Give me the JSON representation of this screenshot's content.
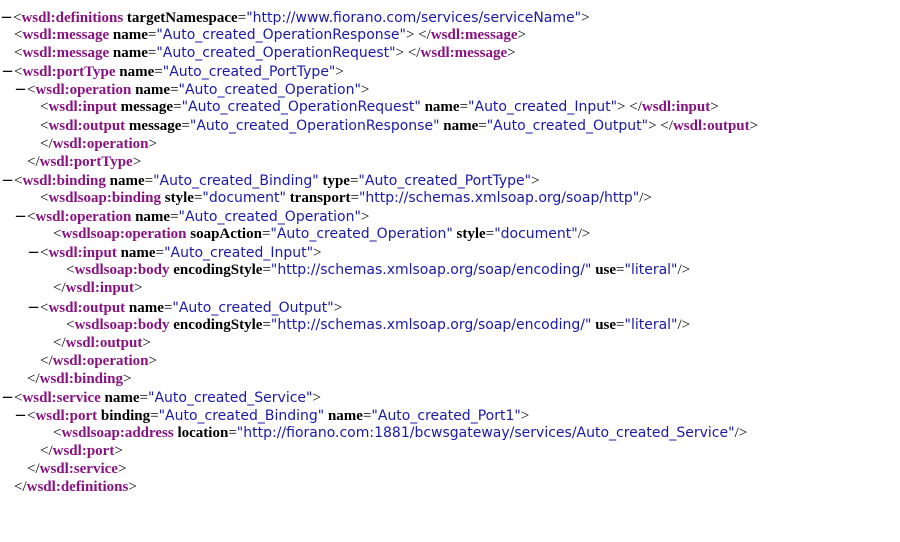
{
  "colors": {
    "background": "#ffffff",
    "tag": "#881280",
    "attr_value": "#1a1aa6",
    "text": "#000000"
  },
  "lines": [
    {
      "depth": 0,
      "toggle": "−",
      "kind": "open",
      "tag": "wsdl:definitions",
      "attrs": [
        {
          "name": "targetNamespace",
          "value": "\"http://www.fiorano.com/services/serviceName\""
        }
      ]
    },
    {
      "depth": 1,
      "toggle": "",
      "kind": "openclose",
      "tag": "wsdl:message",
      "attrs": [
        {
          "name": "name",
          "value": "\"Auto_created_OperationResponse\""
        }
      ]
    },
    {
      "depth": 1,
      "toggle": "",
      "kind": "openclose",
      "tag": "wsdl:message",
      "attrs": [
        {
          "name": "name",
          "value": "\"Auto_created_OperationRequest\""
        }
      ]
    },
    {
      "depth": 1,
      "toggle": "−",
      "kind": "open",
      "tag": "wsdl:portType",
      "attrs": [
        {
          "name": "name",
          "value": "\"Auto_created_PortType\""
        }
      ]
    },
    {
      "depth": 2,
      "toggle": "−",
      "kind": "open",
      "tag": "wsdl:operation",
      "attrs": [
        {
          "name": "name",
          "value": "\"Auto_created_Operation\""
        }
      ]
    },
    {
      "depth": 3,
      "toggle": "",
      "kind": "openclose",
      "tag": "wsdl:input",
      "attrs": [
        {
          "name": "message",
          "value": "\"Auto_created_OperationRequest\""
        },
        {
          "name": "name",
          "value": "\"Auto_created_Input\""
        }
      ]
    },
    {
      "depth": 3,
      "toggle": "",
      "kind": "openclose",
      "tag": "wsdl:output",
      "attrs": [
        {
          "name": "message",
          "value": "\"Auto_created_OperationResponse\""
        },
        {
          "name": "name",
          "value": "\"Auto_created_Output\""
        }
      ]
    },
    {
      "depth": 3,
      "toggle": "",
      "kind": "close",
      "tag": "wsdl:operation",
      "attrs": []
    },
    {
      "depth": 2,
      "toggle": "",
      "kind": "close",
      "tag": "wsdl:portType",
      "attrs": []
    },
    {
      "depth": 1,
      "toggle": "−",
      "kind": "open",
      "tag": "wsdl:binding",
      "attrs": [
        {
          "name": "name",
          "value": "\"Auto_created_Binding\""
        },
        {
          "name": "type",
          "value": "\"Auto_created_PortType\""
        }
      ]
    },
    {
      "depth": 3,
      "toggle": "",
      "kind": "selfclose",
      "tag": "wsdlsoap:binding",
      "attrs": [
        {
          "name": "style",
          "value": "\"document\""
        },
        {
          "name": "transport",
          "value": "\"http://schemas.xmlsoap.org/soap/http\""
        }
      ]
    },
    {
      "depth": 2,
      "toggle": "−",
      "kind": "open",
      "tag": "wsdl:operation",
      "attrs": [
        {
          "name": "name",
          "value": "\"Auto_created_Operation\""
        }
      ]
    },
    {
      "depth": 4,
      "toggle": "",
      "kind": "selfclose",
      "tag": "wsdlsoap:operation",
      "attrs": [
        {
          "name": "soapAction",
          "value": "\"Auto_created_Operation\""
        },
        {
          "name": "style",
          "value": "\"document\""
        }
      ]
    },
    {
      "depth": 3,
      "toggle": "−",
      "kind": "open",
      "tag": "wsdl:input",
      "attrs": [
        {
          "name": "name",
          "value": "\"Auto_created_Input\""
        }
      ]
    },
    {
      "depth": 5,
      "toggle": "",
      "kind": "selfclose",
      "tag": "wsdlsoap:body",
      "attrs": [
        {
          "name": "encodingStyle",
          "value": "\"http://schemas.xmlsoap.org/soap/encoding/\""
        },
        {
          "name": "use",
          "value": "\"literal\""
        }
      ]
    },
    {
      "depth": 4,
      "toggle": "",
      "kind": "close",
      "tag": "wsdl:input",
      "attrs": []
    },
    {
      "depth": 3,
      "toggle": "−",
      "kind": "open",
      "tag": "wsdl:output",
      "attrs": [
        {
          "name": "name",
          "value": "\"Auto_created_Output\""
        }
      ]
    },
    {
      "depth": 5,
      "toggle": "",
      "kind": "selfclose",
      "tag": "wsdlsoap:body",
      "attrs": [
        {
          "name": "encodingStyle",
          "value": "\"http://schemas.xmlsoap.org/soap/encoding/\""
        },
        {
          "name": "use",
          "value": "\"literal\""
        }
      ]
    },
    {
      "depth": 4,
      "toggle": "",
      "kind": "close",
      "tag": "wsdl:output",
      "attrs": []
    },
    {
      "depth": 3,
      "toggle": "",
      "kind": "close",
      "tag": "wsdl:operation",
      "attrs": []
    },
    {
      "depth": 2,
      "toggle": "",
      "kind": "close",
      "tag": "wsdl:binding",
      "attrs": []
    },
    {
      "depth": 1,
      "toggle": "−",
      "kind": "open",
      "tag": "wsdl:service",
      "attrs": [
        {
          "name": "name",
          "value": "\"Auto_created_Service\""
        }
      ]
    },
    {
      "depth": 2,
      "toggle": "−",
      "kind": "open",
      "tag": "wsdl:port",
      "attrs": [
        {
          "name": "binding",
          "value": "\"Auto_created_Binding\""
        },
        {
          "name": "name",
          "value": "\"Auto_created_Port1\""
        }
      ]
    },
    {
      "depth": 4,
      "toggle": "",
      "kind": "selfclose",
      "tag": "wsdlsoap:address",
      "attrs": [
        {
          "name": "location",
          "value": "\"http://fiorano.com:1881/bcwsgateway/services/Auto_created_Service\""
        }
      ]
    },
    {
      "depth": 3,
      "toggle": "",
      "kind": "close",
      "tag": "wsdl:port",
      "attrs": []
    },
    {
      "depth": 2,
      "toggle": "",
      "kind": "close",
      "tag": "wsdl:service",
      "attrs": []
    },
    {
      "depth": 1,
      "toggle": "",
      "kind": "close",
      "tag": "wsdl:definitions",
      "attrs": []
    }
  ]
}
